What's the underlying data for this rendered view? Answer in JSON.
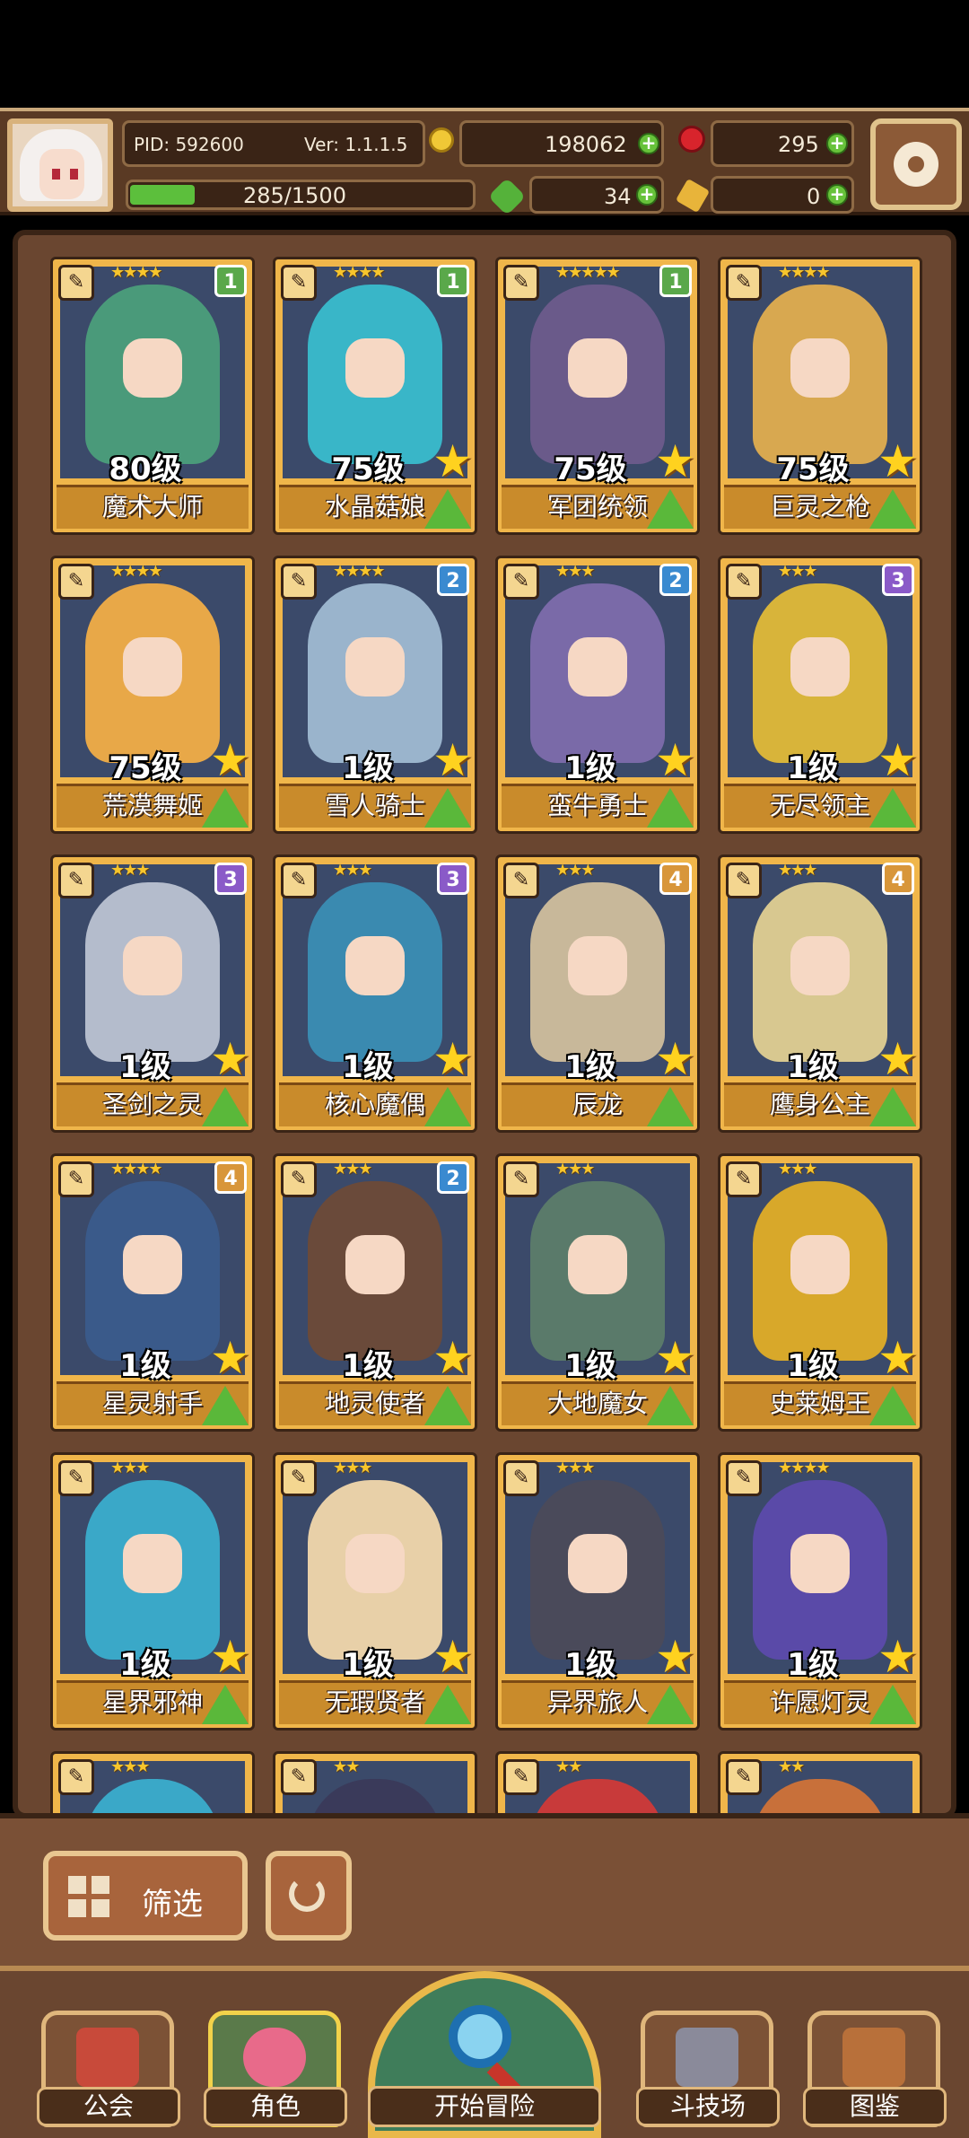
{
  "header": {
    "pid": "PID: 592600",
    "version": "Ver: 1.1.1.5",
    "gold": "198062",
    "gems": "295",
    "xp_text": "285/1500",
    "xp_fraction": 0.19,
    "clover": "34",
    "keys": "0"
  },
  "cards": [
    {
      "name": "魔术大师",
      "level": "80级",
      "stars": "★★★★",
      "num": "1",
      "num_color": "#5aa84a",
      "art": "#4a9a7a"
    },
    {
      "name": "水晶菇娘",
      "level": "75级",
      "stars": "★★★★",
      "num": "1",
      "num_color": "#5aa84a",
      "art": "#39b6c8"
    },
    {
      "name": "军团统领",
      "level": "75级",
      "stars": "★★★★★",
      "num": "1",
      "num_color": "#5aa84a",
      "art": "#6a5a8a"
    },
    {
      "name": "巨灵之枪",
      "level": "75级",
      "stars": "★★★★",
      "num": "",
      "num_color": "",
      "art": "#d8a850"
    },
    {
      "name": "荒漠舞姬",
      "level": "75级",
      "stars": "★★★★",
      "num": "",
      "num_color": "",
      "art": "#e8a848"
    },
    {
      "name": "雪人骑士",
      "level": "1级",
      "stars": "★★★★",
      "num": "2",
      "num_color": "#3a8ad0",
      "art": "#9ab4cc"
    },
    {
      "name": "蛮牛勇士",
      "level": "1级",
      "stars": "★★★",
      "num": "2",
      "num_color": "#3a8ad0",
      "art": "#7a6aa8"
    },
    {
      "name": "无尽领主",
      "level": "1级",
      "stars": "★★★",
      "num": "3",
      "num_color": "#8a5ac8",
      "art": "#d8b43a"
    },
    {
      "name": "圣剑之灵",
      "level": "1级",
      "stars": "★★★",
      "num": "3",
      "num_color": "#8a5ac8",
      "art": "#b4bccc"
    },
    {
      "name": "核心魔偶",
      "level": "1级",
      "stars": "★★★",
      "num": "3",
      "num_color": "#8a5ac8",
      "art": "#3a8ab0"
    },
    {
      "name": "辰龙",
      "level": "1级",
      "stars": "★★★",
      "num": "4",
      "num_color": "#d8963a",
      "art": "#c8b89a"
    },
    {
      "name": "鹰身公主",
      "level": "1级",
      "stars": "★★★",
      "num": "4",
      "num_color": "#d8963a",
      "art": "#d8c890"
    },
    {
      "name": "星灵射手",
      "level": "1级",
      "stars": "★★★★",
      "num": "4",
      "num_color": "#d8963a",
      "art": "#3a5a8a"
    },
    {
      "name": "地灵使者",
      "level": "1级",
      "stars": "★★★",
      "num": "2",
      "num_color": "#3a8ad0",
      "art": "#6a4a3a"
    },
    {
      "name": "大地魔女",
      "level": "1级",
      "stars": "★★★",
      "num": "",
      "num_color": "",
      "art": "#5a7a6a"
    },
    {
      "name": "史莱姆王",
      "level": "1级",
      "stars": "★★★",
      "num": "",
      "num_color": "",
      "art": "#d8a82a"
    },
    {
      "name": "星界邪神",
      "level": "1级",
      "stars": "★★★",
      "num": "",
      "num_color": "",
      "art": "#3aa8c8"
    },
    {
      "name": "无瑕贤者",
      "level": "1级",
      "stars": "★★★",
      "num": "",
      "num_color": "",
      "art": "#e8d0a8"
    },
    {
      "name": "异界旅人",
      "level": "1级",
      "stars": "★★★",
      "num": "",
      "num_color": "",
      "art": "#4a4a5a"
    },
    {
      "name": "许愿灯灵",
      "level": "1级",
      "stars": "★★★★",
      "num": "",
      "num_color": "",
      "art": "#5a4aa8"
    }
  ],
  "partial_cards": [
    {
      "stars": "★★★",
      "art": "#3aa8c8"
    },
    {
      "stars": "★★",
      "art": "#3a3a5a"
    },
    {
      "stars": "★★",
      "art": "#c83a3a"
    },
    {
      "stars": "★★",
      "art": "#c8703a"
    }
  ],
  "controls": {
    "filter_label": "筛选"
  },
  "nav": {
    "guild": "公会",
    "character": "角色",
    "adventure": "开始冒险",
    "arena": "斗技场",
    "codex": "图鉴"
  }
}
